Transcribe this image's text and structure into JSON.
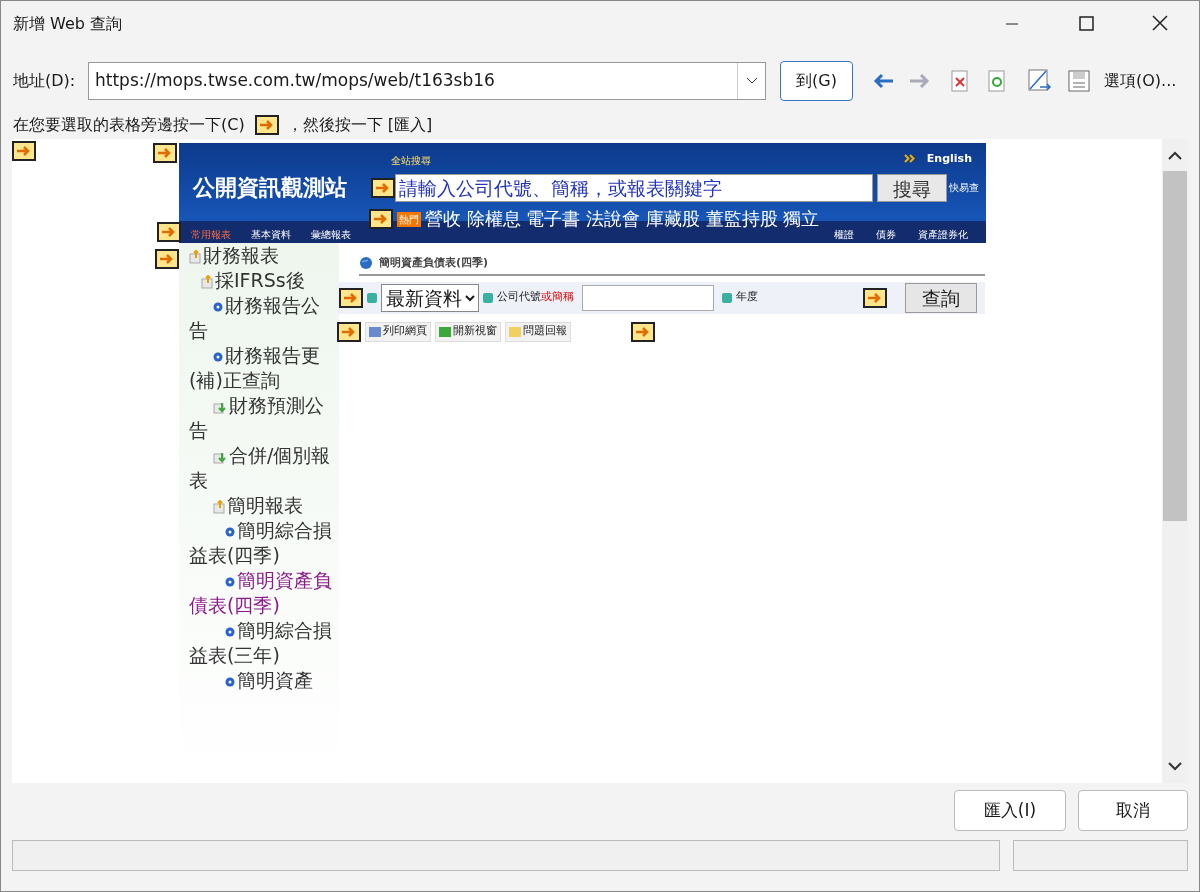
{
  "window": {
    "title": "新增 Web 查詢"
  },
  "address": {
    "label": "地址(D):",
    "value": "https://mops.twse.com.tw/mops/web/t163sb16",
    "go": "到(G)",
    "options": "選項(O)..."
  },
  "instruction": {
    "before": "在您要選取的表格旁邊按一下(C)",
    "after": "，然後按一下 [匯入]"
  },
  "site": {
    "logo": "公開資訊觀測站",
    "search_label": "全站搜尋",
    "english": "English",
    "search_placeholder": "請輸入公司代號、簡稱，或報表關鍵字",
    "search_button": "搜尋",
    "quick": "快易查",
    "hot_links": "營收 除權息 電子書 法說會 庫藏股 董監持股 獨立",
    "badge": "熱門",
    "nav": [
      {
        "label": "常用報表",
        "selected": true
      },
      {
        "label": "基本資料",
        "selected": false
      },
      {
        "label": "彙總報表",
        "selected": false
      },
      {
        "label": "權證",
        "selected": false
      },
      {
        "label": "債券",
        "selected": false
      },
      {
        "label": "資產證券化",
        "selected": false
      }
    ]
  },
  "tree": [
    {
      "label": "財務報表",
      "kind": "folder",
      "selected": false,
      "children": [
        {
          "label": "採IFRSs後",
          "kind": "folder",
          "selected": false,
          "children": [
            {
              "label": "財務報告公告",
              "kind": "bullet",
              "selected": false
            },
            {
              "label": "財務報告更(補)正查詢",
              "kind": "bullet",
              "selected": false
            },
            {
              "label": "財務預測公告",
              "kind": "download",
              "selected": false
            },
            {
              "label": "合併/個別報表",
              "kind": "download",
              "selected": false
            },
            {
              "label": "簡明報表",
              "kind": "folder",
              "selected": false,
              "children": [
                {
                  "label": "簡明綜合損益表(四季)",
                  "kind": "bullet",
                  "selected": false
                },
                {
                  "label": "簡明資產負債表(四季)",
                  "kind": "bullet",
                  "selected": true
                },
                {
                  "label": "簡明綜合損益表(三年)",
                  "kind": "bullet",
                  "selected": false
                },
                {
                  "label": "簡明資產",
                  "kind": "bullet",
                  "selected": false
                }
              ]
            }
          ]
        }
      ]
    }
  ],
  "content": {
    "title": "簡明資產負債表(四季)",
    "period": "最新資料",
    "company_label": "公司代號",
    "company_label_alt": "或簡稱",
    "year_label": "年度",
    "query": "查詢",
    "tools": [
      "列印網頁",
      "開新視窗",
      "問題回報"
    ]
  },
  "buttons": {
    "import": "匯入(I)",
    "cancel": "取消"
  }
}
